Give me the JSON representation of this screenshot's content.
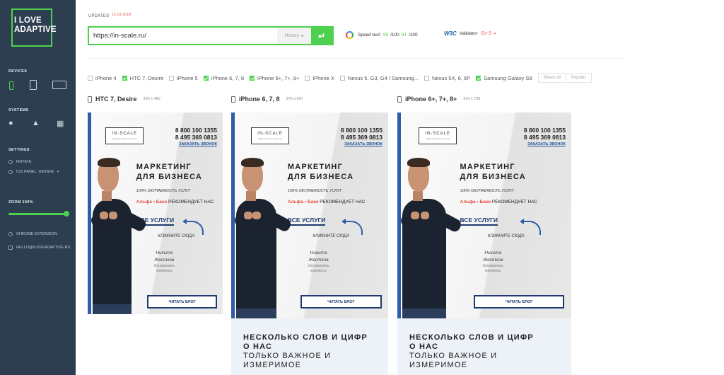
{
  "sidebar": {
    "logo_line1": "I LOVE",
    "logo_line2": "ADAPTIVE",
    "devices_title": "DEVICES",
    "systems_title": "SYSTEMS",
    "settings_title": "SETTINGS",
    "rotate_label": "ROTATE",
    "ios_panel_label": "IOS PANEL: HIDDEN",
    "zoom_label": "ZOOM 100%",
    "zoom_level": 1.0,
    "chrome_ext_label": "CHROME EXTENSION",
    "email_label": "HELLO@ILOVEADAPTIVE.RU",
    "accent_color": "#4ed14e",
    "bg_color": "#2c3e50"
  },
  "top": {
    "updates_label": "UPDATES",
    "updates_date": "12.02.2018",
    "url_value": "https://in-scale.ru/",
    "history_label": "History",
    "go_icon": "return-arrow-icon",
    "speed_label": "Speed test:",
    "speed_mobile": "99",
    "speed_sep1": "/100",
    "speed_desktop": "91",
    "speed_sep2": "/100",
    "validator_label": "Validator:",
    "validator_value": "Err 5"
  },
  "devices": [
    {
      "label": "iPhone 4",
      "checked": false
    },
    {
      "label": "HTC 7, Desire",
      "checked": true
    },
    {
      "label": "iPhone 5",
      "checked": false
    },
    {
      "label": "iPhone 6, 7, 8",
      "checked": true
    },
    {
      "label": "iPhone 6+, 7+, 8+",
      "checked": true
    },
    {
      "label": "iPhone X",
      "checked": false
    },
    {
      "label": "Nexus 5, G3, G4 / Samsung...",
      "checked": false
    },
    {
      "label": "Nexus 5X, 6, 6P",
      "checked": false
    },
    {
      "label": "Samsung Galaxy S8",
      "checked": true
    }
  ],
  "buttons": {
    "select_all": "Select all",
    "popular": "Popular"
  },
  "previews": [
    {
      "name": "HTC 7, Desire",
      "res": "320 x 480"
    },
    {
      "name": "iPhone 6, 7, 8",
      "res": "375 x 667"
    },
    {
      "name": "iPhone 6+, 7+, 8+",
      "res": "414 x 736"
    }
  ],
  "site": {
    "logo": "IN-SCALE",
    "logo_sub": "маркетинговое агентство",
    "phone1": "8 800 100 1355",
    "phone2": "8 495 369 0813",
    "call": "ЗАКАЗАТЬ ЗВОНОК",
    "head1": "МАРКЕТИНГ",
    "head2": "ДЛЯ БИЗНЕСА",
    "sub": "100% ОКУПАЕМОСТЬ УСЛУГ",
    "bank": "Альфа • Банк",
    "bank_rec": "РЕКОМЕНДУЕТ НАС",
    "uslugi": "ВСЕ УСЛУГИ",
    "click": "КЛИКНИТЕ СЮДА",
    "person1": "Никита",
    "person2": "Жестков",
    "role1": "Основатель",
    "role2": "компании",
    "blog": "ЧИТАТЬ БЛОГ",
    "bottom1": "НЕСКОЛЬКО СЛОВ И ЦИФР",
    "bottom2": "О НАС",
    "bottom3": "ТОЛЬКО ВАЖНОЕ И",
    "bottom4": "ИЗМЕРИМОЕ"
  }
}
